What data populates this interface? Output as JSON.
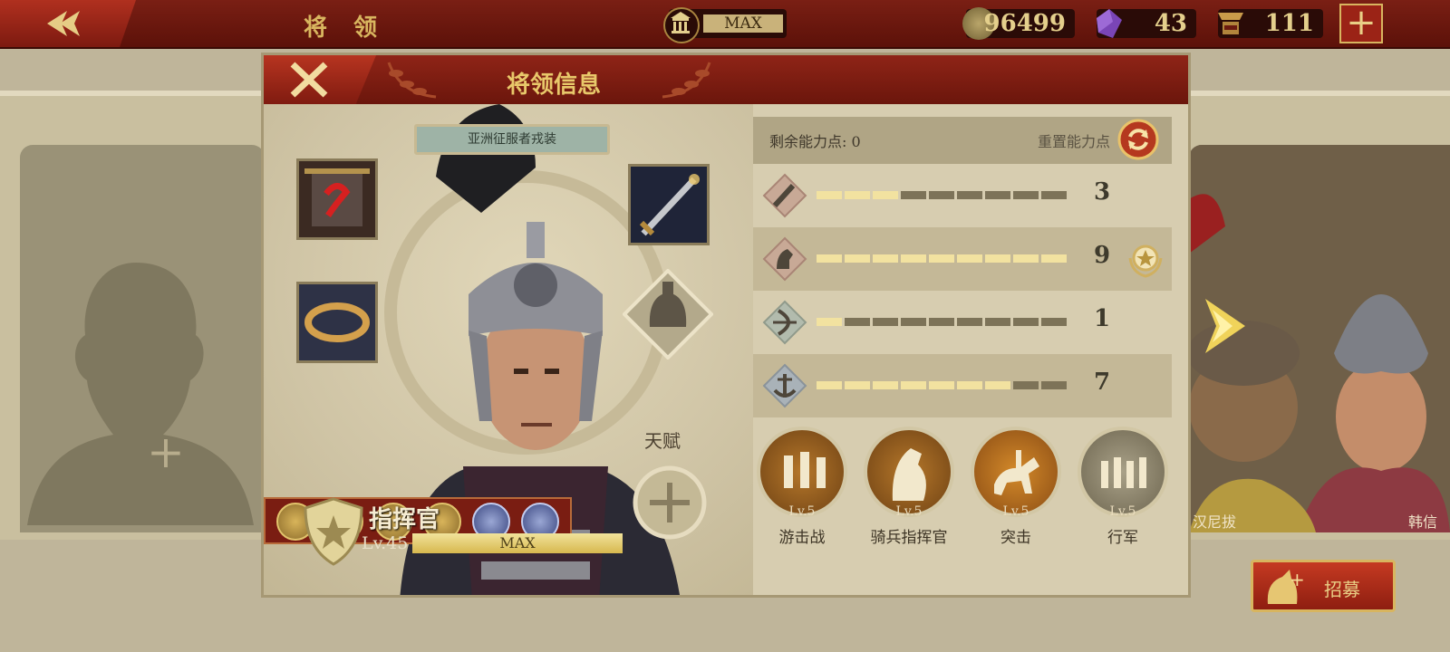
{
  "topbar": {
    "title": "将 领",
    "building_level": "MAX",
    "coins": "96499",
    "gems": "43",
    "spqr_tokens": "111",
    "plus_label": "+"
  },
  "background": {
    "empty_slot_plus": "+",
    "right_hero_names": [
      "汉尼拔",
      "韩信"
    ],
    "recruit_label": "招募"
  },
  "panel": {
    "title": "将领信息",
    "outfit_tag": "亚洲征服者戎装",
    "talent_label": "天赋",
    "commander": {
      "rank": "指挥官",
      "level": "Lv.45",
      "exp_label": "MAX"
    },
    "stats": {
      "remaining_label": "剩余能力点: 0",
      "reset_label": "重置能力点",
      "rows": [
        {
          "icon": "sword-icon",
          "value": "3",
          "level": 3
        },
        {
          "icon": "horse-icon",
          "value": "9",
          "level": 9
        },
        {
          "icon": "bow-icon",
          "value": "1",
          "level": 1
        },
        {
          "icon": "anchor-icon",
          "value": "7",
          "level": 7
        }
      ]
    },
    "skills": [
      {
        "level": "Lv.5",
        "name": "游击战",
        "icon": "skirmish-icon"
      },
      {
        "level": "Lv.5",
        "name": "骑兵指挥官",
        "icon": "cavalry-horse-icon"
      },
      {
        "level": "Lv.5",
        "name": "突击",
        "icon": "charge-icon"
      },
      {
        "level": "Lv.5",
        "name": "行军",
        "icon": "march-icon"
      }
    ]
  },
  "colors": {
    "accent_gold": "#e8c86a",
    "header_red": "#7a1f14",
    "bar_fill": "#f2e2a0",
    "bar_empty": "#7d7358"
  }
}
